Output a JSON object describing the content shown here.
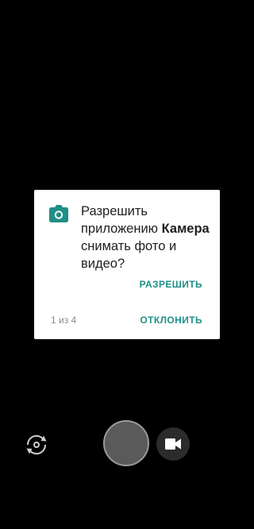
{
  "dialog": {
    "message_prefix": "Разрешить приложению ",
    "app_name": "Камера",
    "message_suffix": " снимать фото и видео?",
    "allow_label": "РАЗРЕШИТЬ",
    "deny_label": "ОТКЛОНИТЬ",
    "counter": "1 из 4",
    "icon": "camera-icon",
    "accent_color": "#1f8f87"
  },
  "camera_controls": {
    "switch_icon": "switch-camera-icon",
    "shutter_icon": "shutter-button",
    "video_icon": "video-camera-icon"
  }
}
